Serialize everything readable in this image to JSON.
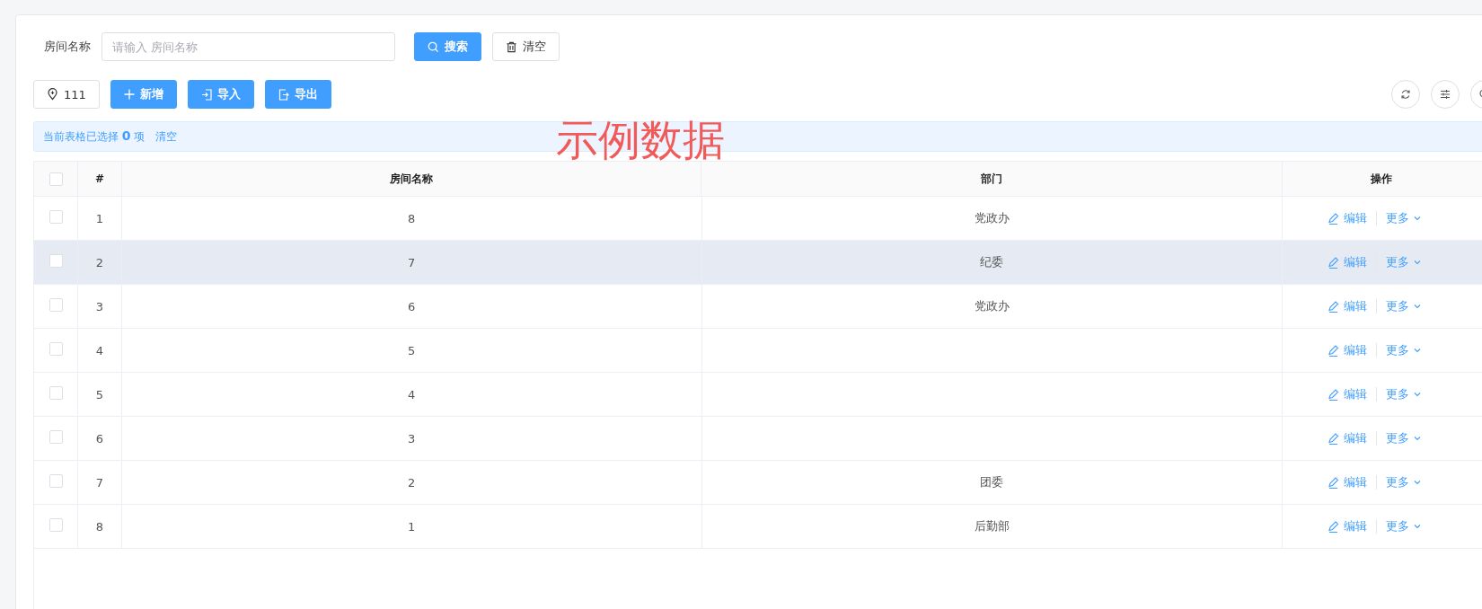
{
  "search_form": {
    "label": "房间名称",
    "placeholder": "请输入 房间名称",
    "buttons": [
      {
        "kind": "search",
        "label": "搜索"
      },
      {
        "kind": "clear",
        "label": "清空"
      }
    ]
  },
  "toolbar": {
    "buttons": [
      {
        "kind": "pin",
        "label": "111"
      },
      {
        "kind": "add",
        "label": "新增"
      },
      {
        "kind": "import",
        "label": "导入"
      },
      {
        "kind": "export",
        "label": "导出"
      }
    ],
    "tools": [
      {
        "kind": "refresh"
      },
      {
        "kind": "columns"
      },
      {
        "kind": "search"
      }
    ]
  },
  "selection_bar": {
    "prefix": "当前表格已选择",
    "count": "0",
    "suffix": "项",
    "clear_link": "清空"
  },
  "overlay_label": "示例数据",
  "table": {
    "header_checked": false,
    "columns": [
      "#",
      "房间名称",
      "部门",
      "操作"
    ],
    "rows": [
      {
        "index": "1",
        "room": "8",
        "dept": "党政办",
        "checked": false,
        "hovered": false,
        "edit": "编辑",
        "more": "更多"
      },
      {
        "index": "2",
        "room": "7",
        "dept": "纪委",
        "checked": false,
        "hovered": true,
        "edit": "编辑",
        "more": "更多"
      },
      {
        "index": "3",
        "room": "6",
        "dept": "党政办",
        "checked": false,
        "hovered": false,
        "edit": "编辑",
        "more": "更多"
      },
      {
        "index": "4",
        "room": "5",
        "dept": "",
        "checked": false,
        "hovered": false,
        "edit": "编辑",
        "more": "更多"
      },
      {
        "index": "5",
        "room": "4",
        "dept": "",
        "checked": false,
        "hovered": false,
        "edit": "编辑",
        "more": "更多"
      },
      {
        "index": "6",
        "room": "3",
        "dept": "",
        "checked": false,
        "hovered": false,
        "edit": "编辑",
        "more": "更多"
      },
      {
        "index": "7",
        "room": "2",
        "dept": "团委",
        "checked": false,
        "hovered": false,
        "edit": "编辑",
        "more": "更多"
      },
      {
        "index": "8",
        "room": "1",
        "dept": "后勤部",
        "checked": false,
        "hovered": false,
        "edit": "编辑",
        "more": "更多"
      }
    ]
  }
}
